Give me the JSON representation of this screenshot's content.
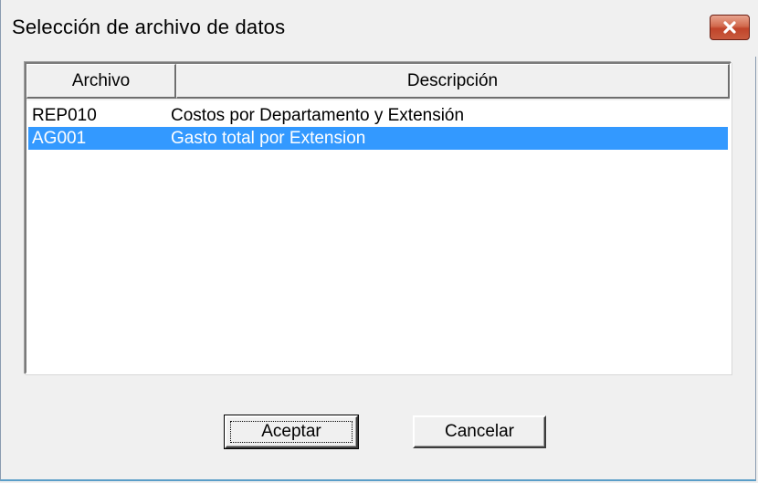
{
  "window": {
    "title": "Selección de archivo de datos",
    "close_icon": "close-icon"
  },
  "list": {
    "columns": [
      "Archivo",
      "Descripción"
    ],
    "rows": [
      {
        "archivo": "REP010",
        "descripcion": "Costos por Departamento y Extensión",
        "selected": false
      },
      {
        "archivo": "AG001",
        "descripcion": "Gasto total por Extension",
        "selected": true
      }
    ]
  },
  "buttons": {
    "ok_label": "Aceptar",
    "cancel_label": "Cancelar"
  },
  "colors": {
    "selection": "#3399ff",
    "close_button": "#c0442a"
  }
}
